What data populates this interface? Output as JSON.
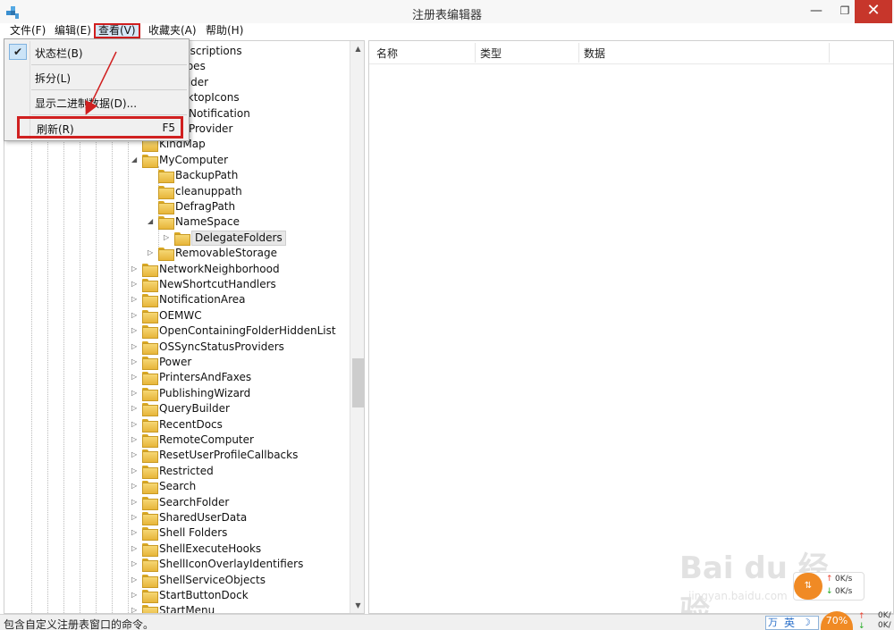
{
  "window": {
    "title": "注册表编辑器",
    "minimize_glyph": "—",
    "maximize_glyph": "❐",
    "close_glyph": "✕"
  },
  "menubar": {
    "file": "文件(F)",
    "edit": "编辑(E)",
    "view": "查看(V)",
    "favorites": "收藏夹(A)",
    "help": "帮助(H)"
  },
  "view_menu": {
    "statusbar": "状态栏(B)",
    "statusbar_checked": true,
    "split": "拆分(L)",
    "binary": "显示二进制数据(D)...",
    "refresh": "刷新(R)",
    "refresh_shortcut": "F5",
    "check_glyph": "✔"
  },
  "tree": {
    "nodes": [
      {
        "label": "Descriptions",
        "expander": ""
      },
      {
        "label": "Types",
        "expander": ""
      },
      {
        "label": "Folder",
        "expander": ""
      },
      {
        "label": "esktopIcons",
        "expander": ""
      },
      {
        "label": "agNotification",
        "expander": ""
      },
      {
        "label": "agProvider",
        "expander": ""
      },
      {
        "label": "KindMap",
        "expander": ""
      },
      {
        "label": "MyComputer",
        "expander": "◢"
      },
      {
        "label": "BackupPath",
        "expander": ""
      },
      {
        "label": "cleanuppath",
        "expander": ""
      },
      {
        "label": "DefragPath",
        "expander": ""
      },
      {
        "label": "NameSpace",
        "expander": "◢"
      },
      {
        "label": "DelegateFolders",
        "expander": "▷"
      },
      {
        "label": "RemovableStorage",
        "expander": "▷"
      },
      {
        "label": "NetworkNeighborhood",
        "expander": "▷"
      },
      {
        "label": "NewShortcutHandlers",
        "expander": "▷"
      },
      {
        "label": "NotificationArea",
        "expander": "▷"
      },
      {
        "label": "OEMWC",
        "expander": "▷"
      },
      {
        "label": "OpenContainingFolderHiddenList",
        "expander": "▷"
      },
      {
        "label": "OSSyncStatusProviders",
        "expander": "▷"
      },
      {
        "label": "Power",
        "expander": "▷"
      },
      {
        "label": "PrintersAndFaxes",
        "expander": "▷"
      },
      {
        "label": "PublishingWizard",
        "expander": "▷"
      },
      {
        "label": "QueryBuilder",
        "expander": "▷"
      },
      {
        "label": "RecentDocs",
        "expander": "▷"
      },
      {
        "label": "RemoteComputer",
        "expander": "▷"
      },
      {
        "label": "ResetUserProfileCallbacks",
        "expander": "▷"
      },
      {
        "label": "Restricted",
        "expander": "▷"
      },
      {
        "label": "Search",
        "expander": "▷"
      },
      {
        "label": "SearchFolder",
        "expander": "▷"
      },
      {
        "label": "SharedUserData",
        "expander": "▷"
      },
      {
        "label": "Shell Folders",
        "expander": "▷"
      },
      {
        "label": "ShellExecuteHooks",
        "expander": "▷"
      },
      {
        "label": "ShellIconOverlayIdentifiers",
        "expander": "▷"
      },
      {
        "label": "ShellServiceObjects",
        "expander": "▷"
      },
      {
        "label": "StartButtonDock",
        "expander": "▷"
      },
      {
        "label": "StartMenu",
        "expander": "▷"
      }
    ],
    "selected": "DelegateFolders"
  },
  "list": {
    "columns": [
      "名称",
      "类型",
      "数据"
    ]
  },
  "statusbar": {
    "text": "包含自定义注册表窗口的命令。"
  },
  "tray": {
    "ime_icon": "万",
    "ime_lang": "英",
    "ime_moon": "☽",
    "cpu_percent": "70%",
    "net_up": "0K/s",
    "net_down": "0K/s",
    "tray_up": "0K/",
    "tray_down": "0K/"
  },
  "watermark": {
    "main": "Bai du 经验",
    "sub": "jingyan.baidu.com"
  },
  "colors": {
    "highlight_red": "#d02020",
    "menu_bg": "#f0f0f0",
    "close_button": "#c7362b",
    "accent_blue": "#2a6fc9",
    "net_orange": "#f08a24"
  }
}
